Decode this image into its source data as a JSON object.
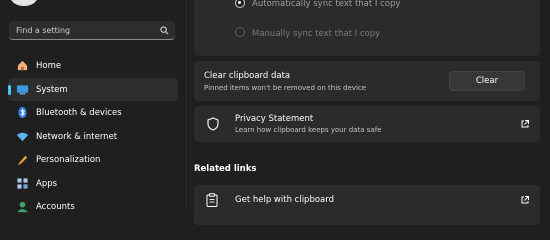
{
  "sidebar": {
    "search": {
      "placeholder": "Find a setting"
    },
    "items": [
      {
        "label": "Home",
        "icon": "home-icon"
      },
      {
        "label": "System",
        "icon": "system-icon",
        "active": true
      },
      {
        "label": "Bluetooth & devices",
        "icon": "bluetooth-icon"
      },
      {
        "label": "Network & internet",
        "icon": "wifi-icon"
      },
      {
        "label": "Personalization",
        "icon": "brush-icon"
      },
      {
        "label": "Apps",
        "icon": "apps-icon"
      },
      {
        "label": "Accounts",
        "icon": "accounts-icon"
      }
    ]
  },
  "main": {
    "sync": {
      "auto_label": "Automatically sync text that I copy",
      "manual_label": "Manually sync text that I copy"
    },
    "clear": {
      "title": "Clear clipboard data",
      "subtitle": "Pinned items won't be removed on this device",
      "button": "Clear"
    },
    "privacy": {
      "title": "Privacy Statement",
      "subtitle": "Learn how clipboard keeps your data safe"
    },
    "related_links": {
      "heading": "Related links",
      "help_title": "Get help with clipboard"
    }
  },
  "colors": {
    "background": "#1f1f1f",
    "card": "#2b2b2b",
    "accent": "#4cc2ff"
  }
}
